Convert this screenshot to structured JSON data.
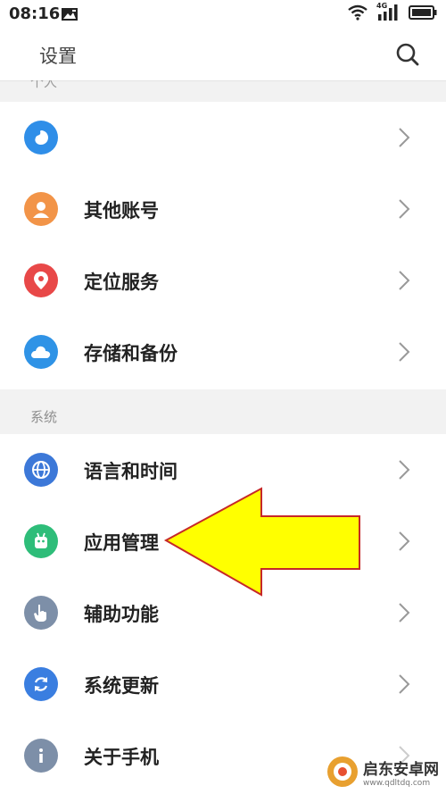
{
  "status_bar": {
    "time": "08:16",
    "network": "4G"
  },
  "header": {
    "title": "设置"
  },
  "account_section": {
    "cutoff_label": "个人",
    "items": [
      {
        "label": "",
        "icon": "flyme-account-icon",
        "color": "#2f8ee8"
      },
      {
        "label": "其他账号",
        "icon": "person-icon",
        "color": "#f29448"
      },
      {
        "label": "定位服务",
        "icon": "location-pin-icon",
        "color": "#e84848"
      },
      {
        "label": "存储和备份",
        "icon": "cloud-icon",
        "color": "#2f93e6"
      }
    ]
  },
  "system_section": {
    "label": "系统",
    "items": [
      {
        "label": "语言和时间",
        "icon": "globe-icon",
        "color": "#3c78d8"
      },
      {
        "label": "应用管理",
        "icon": "android-icon",
        "color": "#2ebd79"
      },
      {
        "label": "辅助功能",
        "icon": "hand-icon",
        "color": "#7d8fa8"
      },
      {
        "label": "系统更新",
        "icon": "refresh-icon",
        "color": "#3a7ee0"
      },
      {
        "label": "关于手机",
        "icon": "info-icon",
        "color": "#7d8fa8"
      }
    ]
  },
  "annotation": {
    "arrow_color": "#ffff00",
    "arrow_border": "#c62828"
  },
  "watermark": {
    "main": "启东安卓网",
    "sub": "www.qdltdq.com"
  }
}
